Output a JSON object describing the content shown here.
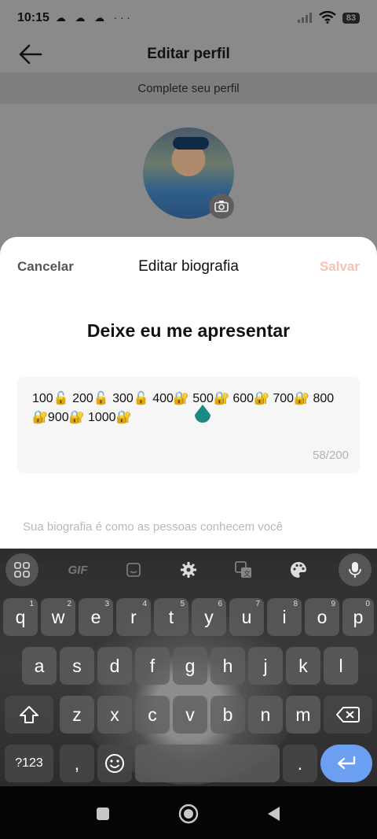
{
  "status_bar": {
    "time": "10:15",
    "notifications": "☁ ☁ ☁ ···",
    "battery": "83"
  },
  "top_bar": {
    "title": "Editar perfil"
  },
  "banner": {
    "text": "Complete seu perfil"
  },
  "sheet": {
    "cancel_label": "Cancelar",
    "title": "Editar biografia",
    "save_label": "Salvar",
    "heading": "Deixe eu me apresentar",
    "bio_value": "100🔓 200🔓 300🔓 400🔐 500🔐 600🔐 700🔐 800🔐900🔐 1000🔐",
    "counter": "58/200",
    "hint": "Sua biografia é como as pessoas conhecem você"
  },
  "keyboard": {
    "toolbar": {
      "gif_label": "GIF"
    },
    "row1": [
      {
        "k": "q",
        "n": "1"
      },
      {
        "k": "w",
        "n": "2"
      },
      {
        "k": "e",
        "n": "3"
      },
      {
        "k": "r",
        "n": "4"
      },
      {
        "k": "t",
        "n": "5"
      },
      {
        "k": "y",
        "n": "6"
      },
      {
        "k": "u",
        "n": "7"
      },
      {
        "k": "i",
        "n": "8"
      },
      {
        "k": "o",
        "n": "9"
      },
      {
        "k": "p",
        "n": "0"
      }
    ],
    "row2": [
      "a",
      "s",
      "d",
      "f",
      "g",
      "h",
      "j",
      "k",
      "l"
    ],
    "row3": [
      "z",
      "x",
      "c",
      "v",
      "b",
      "n",
      "m"
    ],
    "symbols_label": "?123",
    "comma_label": ",",
    "period_label": "."
  },
  "colors": {
    "accent_save": "#f7c2b4",
    "enter_key": "#6b9ff2"
  },
  "icons": {
    "back": "arrow-left-icon",
    "camera": "camera-icon",
    "menu": "grid-icon",
    "sticker": "sticker-icon",
    "settings": "gear-icon",
    "translate": "translate-icon",
    "theme": "palette-icon",
    "mic": "mic-icon",
    "shift": "shift-icon",
    "backspace": "backspace-icon",
    "emoji": "emoji-icon",
    "enter": "enter-icon"
  }
}
